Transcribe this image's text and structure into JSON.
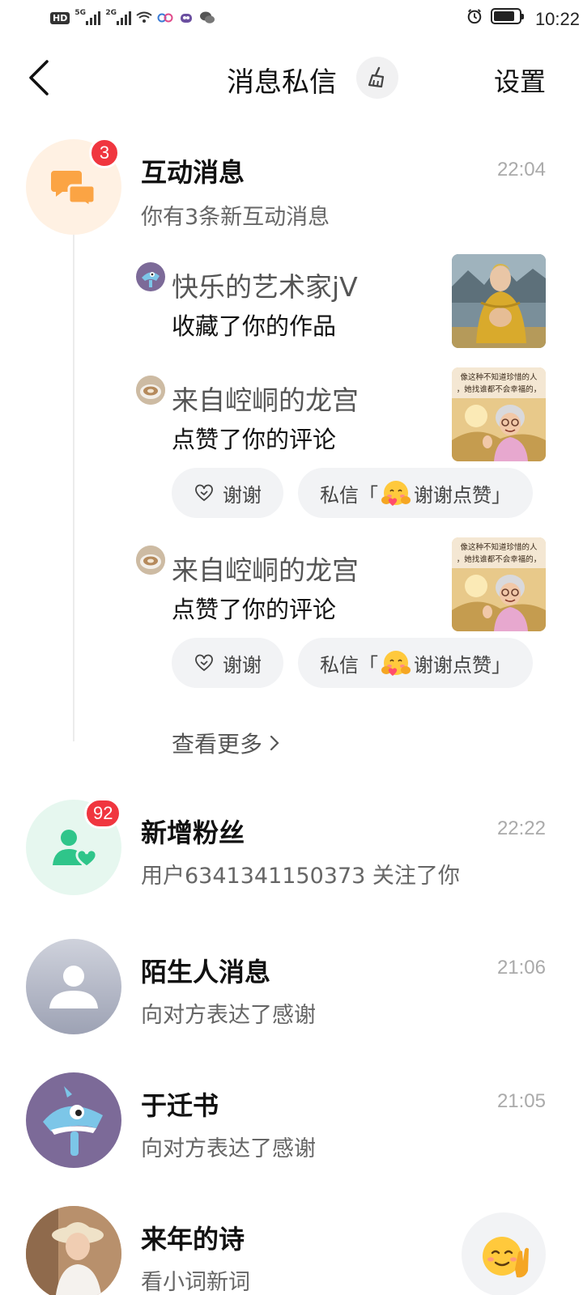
{
  "status_bar": {
    "hd": "HD",
    "net1": "5G",
    "net2": "2G",
    "time": "10:22"
  },
  "header": {
    "title": "消息私信",
    "settings_label": "设置"
  },
  "interaction": {
    "title": "互动消息",
    "subtitle": "你有3条新互动消息",
    "time": "22:04",
    "badge": "3",
    "items": [
      {
        "name": "快乐的艺术家jV",
        "action": "收藏了你的作品"
      },
      {
        "name": "来自崆峒的龙宫",
        "action": "点赞了你的评论",
        "thanks": "谢谢",
        "dm_prefix": "私信「",
        "dm_text": "谢谢点赞」"
      },
      {
        "name": "来自崆峒的龙宫",
        "action": "点赞了你的评论",
        "thanks": "谢谢",
        "dm_prefix": "私信「",
        "dm_text": "谢谢点赞」"
      }
    ],
    "thumb_caption_line1": "像这种不知道珍惜的人",
    "thumb_caption_line2": "，她找谁都不会幸福的，",
    "see_more": "查看更多"
  },
  "new_fans": {
    "title": "新增粉丝",
    "subtitle": "用户6341341150373 关注了你",
    "time": "22:22",
    "badge": "92"
  },
  "stranger": {
    "title": "陌生人消息",
    "subtitle": "向对方表达了感谢",
    "time": "21:06"
  },
  "yu": {
    "title": "于迁书",
    "subtitle": "向对方表达了感谢",
    "time": "21:05"
  },
  "lainian": {
    "title": "来年的诗",
    "subtitle": "看小词新词"
  },
  "colors": {
    "badge": "#f0363f",
    "interaction_bg": "#fff1e3",
    "interaction_icon": "#fba444",
    "fans_bg": "#e6f7ef",
    "fans_icon": "#2fc58a",
    "stranger_bg": "#a9aebf",
    "yu_bg": "#7c6a98"
  }
}
